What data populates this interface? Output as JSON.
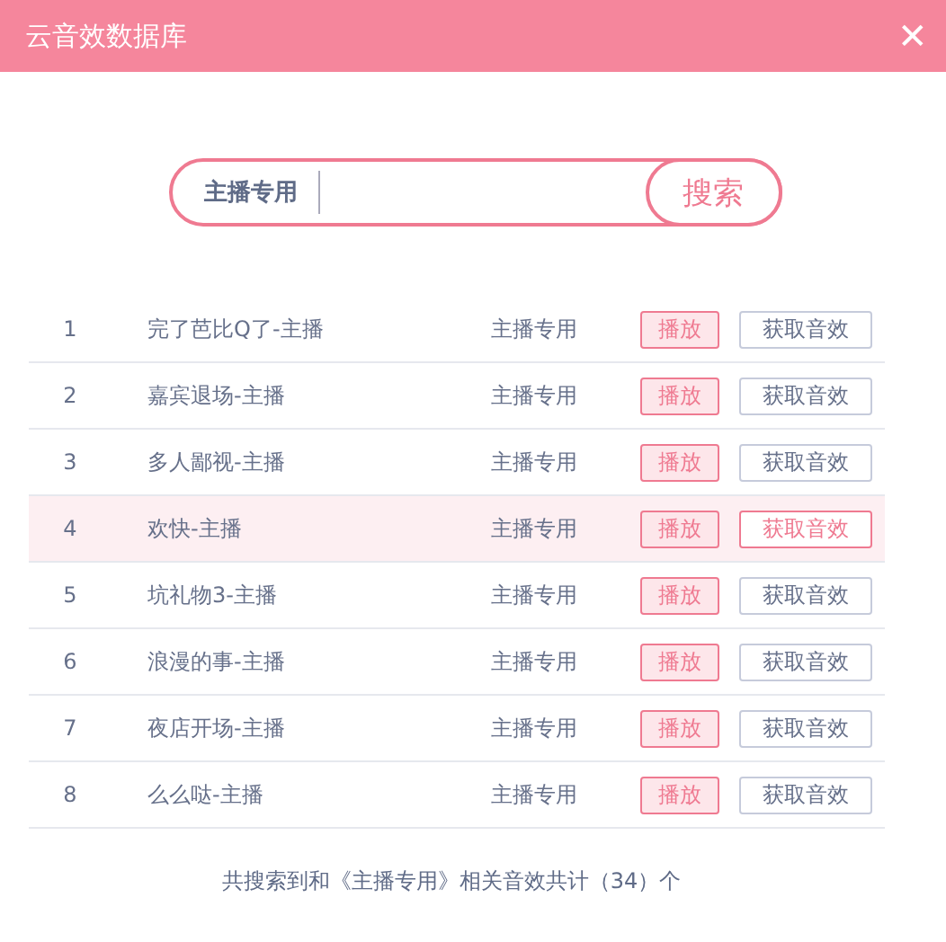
{
  "window": {
    "title": "云音效数据库",
    "close": "✕"
  },
  "search": {
    "category": "主播专用",
    "button": "搜索"
  },
  "rows": [
    {
      "index": "1",
      "name": "完了芭比Q了-主播",
      "category": "主播专用",
      "play": "播放",
      "get": "获取音效",
      "selected": false
    },
    {
      "index": "2",
      "name": "嘉宾退场-主播",
      "category": "主播专用",
      "play": "播放",
      "get": "获取音效",
      "selected": false
    },
    {
      "index": "3",
      "name": "多人鄙视-主播",
      "category": "主播专用",
      "play": "播放",
      "get": "获取音效",
      "selected": false
    },
    {
      "index": "4",
      "name": "欢快-主播",
      "category": "主播专用",
      "play": "播放",
      "get": "获取音效",
      "selected": true
    },
    {
      "index": "5",
      "name": "坑礼物3-主播",
      "category": "主播专用",
      "play": "播放",
      "get": "获取音效",
      "selected": false
    },
    {
      "index": "6",
      "name": "浪漫的事-主播",
      "category": "主播专用",
      "play": "播放",
      "get": "获取音效",
      "selected": false
    },
    {
      "index": "7",
      "name": "夜店开场-主播",
      "category": "主播专用",
      "play": "播放",
      "get": "获取音效",
      "selected": false
    },
    {
      "index": "8",
      "name": "么么哒-主播",
      "category": "主播专用",
      "play": "播放",
      "get": "获取音效",
      "selected": false
    }
  ],
  "footer": "共搜索到和《主播专用》相关音效共计（34）个"
}
